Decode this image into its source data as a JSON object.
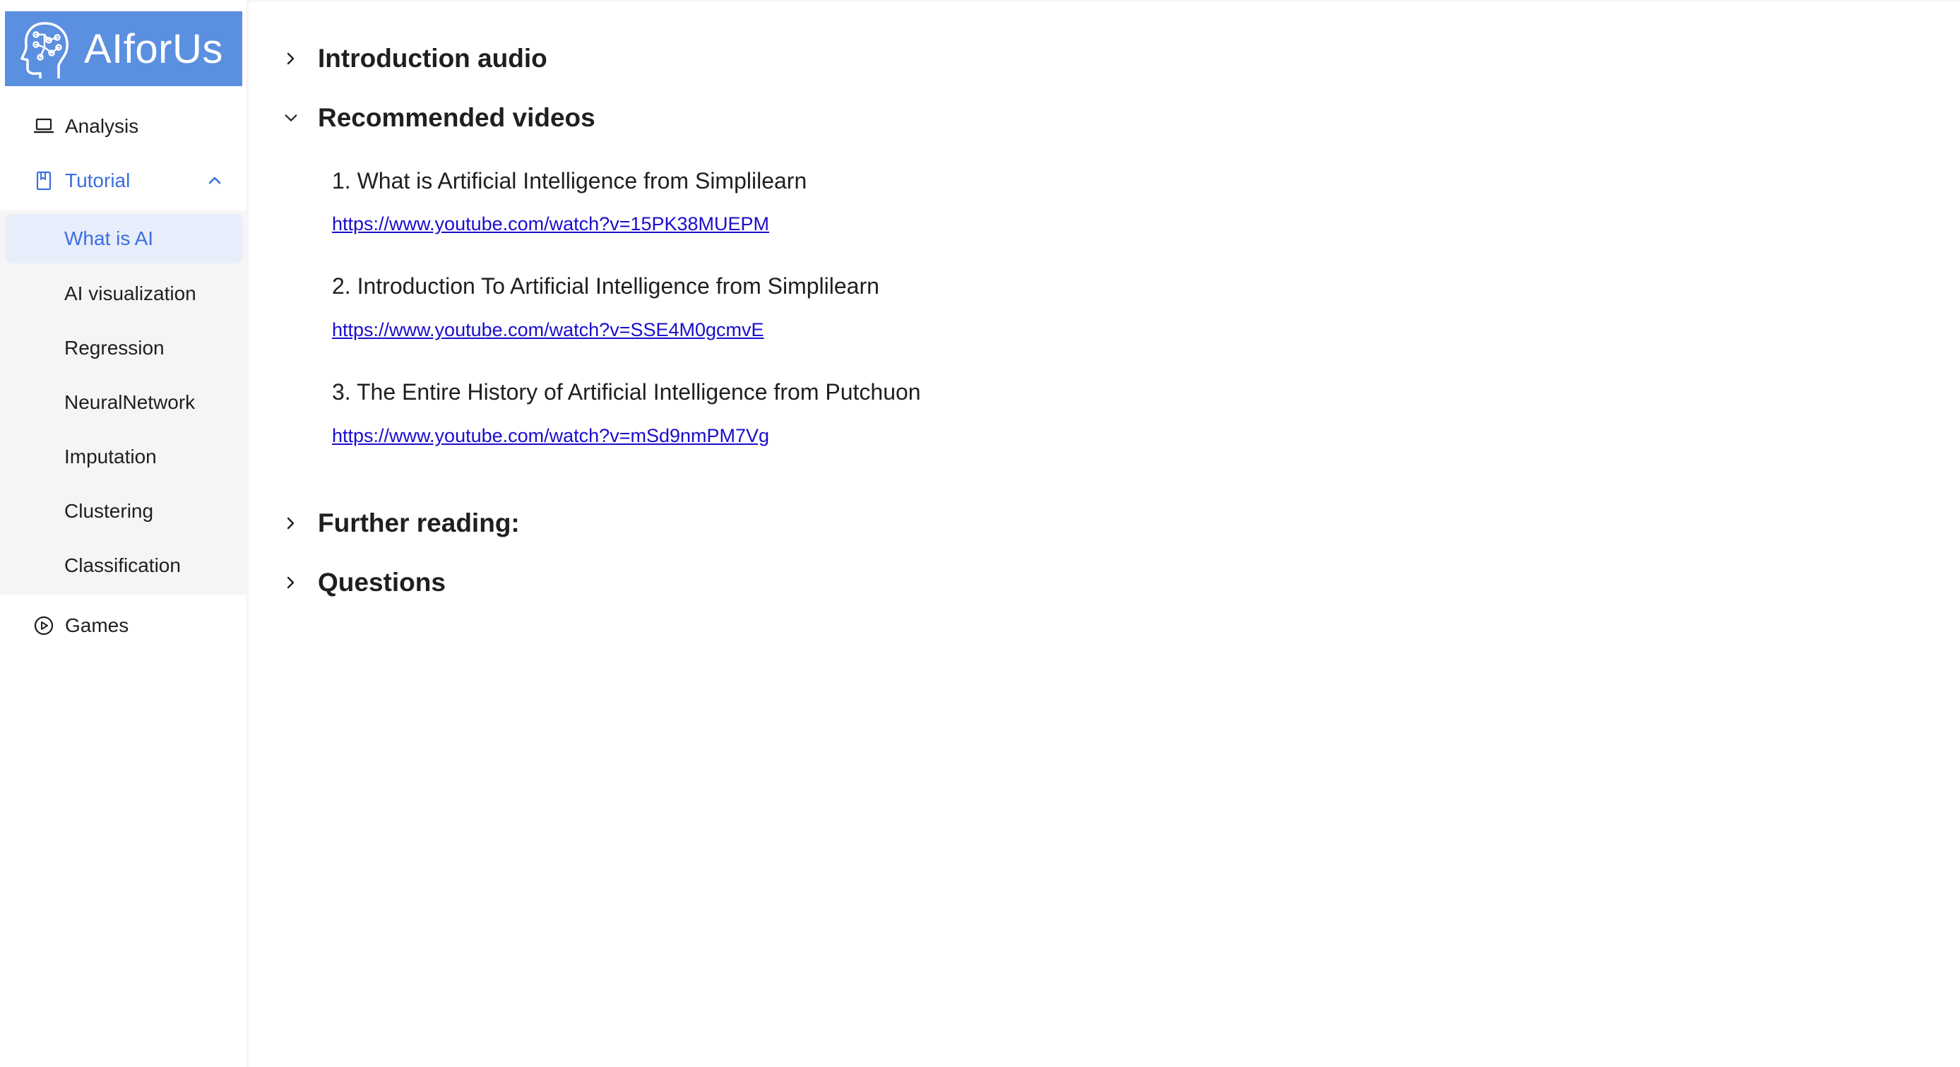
{
  "brand": {
    "name": "AIforUs"
  },
  "sidebar": {
    "items": [
      {
        "label": "Analysis",
        "icon": "laptop-icon"
      },
      {
        "label": "Tutorial",
        "icon": "book-icon",
        "expanded": true
      },
      {
        "label": "Games",
        "icon": "play-circle-icon"
      }
    ],
    "tutorial_children": [
      {
        "label": "What is AI",
        "selected": true
      },
      {
        "label": "AI visualization"
      },
      {
        "label": "Regression"
      },
      {
        "label": "NeuralNetwork"
      },
      {
        "label": "Imputation"
      },
      {
        "label": "Clustering"
      },
      {
        "label": "Classification"
      }
    ]
  },
  "main": {
    "sections": [
      {
        "title": "Introduction audio",
        "expanded": false
      },
      {
        "title": "Recommended videos",
        "expanded": true
      },
      {
        "title": "Further reading:",
        "expanded": false
      },
      {
        "title": "Questions",
        "expanded": false
      }
    ],
    "videos": [
      {
        "title": "1. What is Artificial Intelligence from Simplilearn",
        "url": "https://www.youtube.com/watch?v=15PK38MUEPM"
      },
      {
        "title": "2. Introduction To Artificial Intelligence from Simplilearn",
        "url": "https://www.youtube.com/watch?v=SSE4M0gcmvE"
      },
      {
        "title": "3. The Entire History of Artificial Intelligence from Putchuon",
        "url": "https://www.youtube.com/watch?v=mSd9nmPM7Vg"
      }
    ]
  },
  "colors": {
    "brand_bg": "#5b8fe0",
    "accent": "#3b6fe0",
    "selected_bg": "#e8edfb",
    "link": "#1a0dcc"
  }
}
